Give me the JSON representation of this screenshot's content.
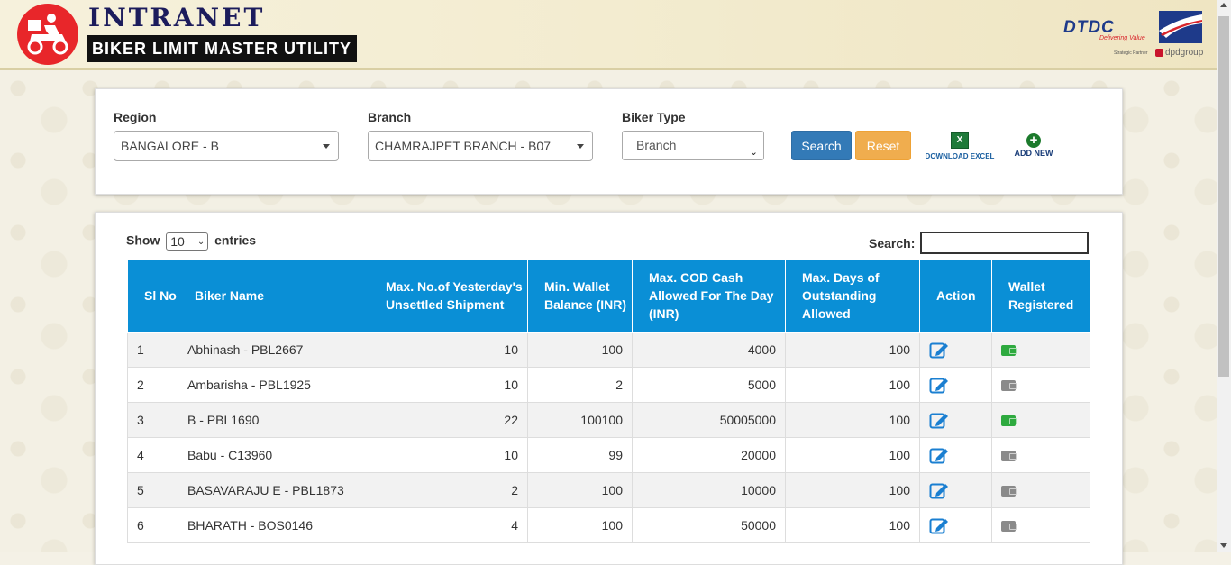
{
  "header": {
    "title": "INTRANET",
    "subtitle": "BIKER LIMIT MASTER UTILITY",
    "partner_brand": "DTDC",
    "partner_tagline": "Delivering Value",
    "partner_note": "Strategic Partner",
    "partner_group": "dpdgroup"
  },
  "filters": {
    "region": {
      "label": "Region",
      "value": "BANGALORE - B"
    },
    "branch": {
      "label": "Branch",
      "value": "CHAMRAJPET BRANCH - B07"
    },
    "biker_type": {
      "label": "Biker Type",
      "value": "Branch"
    },
    "search_label": "Search",
    "reset_label": "Reset",
    "download_label": "DOWNLOAD EXCEL",
    "add_label": "ADD NEW",
    "colors": {
      "search": "#337ab7",
      "reset": "#f0ad4e"
    }
  },
  "table_controls": {
    "show_label": "Show",
    "page_size": "10",
    "entries_label": "entries",
    "search_label": "Search:"
  },
  "table": {
    "header_color": "#0a8fd6",
    "columns": [
      "Sl No",
      "Biker Name",
      "Max. No.of Yesterday's Unsettled Shipment",
      "Min. Wallet Balance (INR)",
      "Max. COD Cash Allowed For The Day (INR)",
      "Max. Days of Outstanding Allowed",
      "Action",
      "Wallet Registered"
    ],
    "rows": [
      {
        "sl": "1",
        "name": "Abhinash - PBL2667",
        "unsettled": "10",
        "wallet": "100",
        "cod": "4000",
        "days": "100",
        "wallet_registered": true
      },
      {
        "sl": "2",
        "name": "Ambarisha - PBL1925",
        "unsettled": "10",
        "wallet": "2",
        "cod": "5000",
        "days": "100",
        "wallet_registered": false
      },
      {
        "sl": "3",
        "name": "B - PBL1690",
        "unsettled": "22",
        "wallet": "100100",
        "cod": "50005000",
        "days": "100",
        "wallet_registered": true
      },
      {
        "sl": "4",
        "name": "Babu - C13960",
        "unsettled": "10",
        "wallet": "99",
        "cod": "20000",
        "days": "100",
        "wallet_registered": false
      },
      {
        "sl": "5",
        "name": "BASAVARAJU E - PBL1873",
        "unsettled": "2",
        "wallet": "100",
        "cod": "10000",
        "days": "100",
        "wallet_registered": false
      },
      {
        "sl": "6",
        "name": "BHARATH - BOS0146",
        "unsettled": "4",
        "wallet": "100",
        "cod": "50000",
        "days": "100",
        "wallet_registered": false
      }
    ]
  }
}
